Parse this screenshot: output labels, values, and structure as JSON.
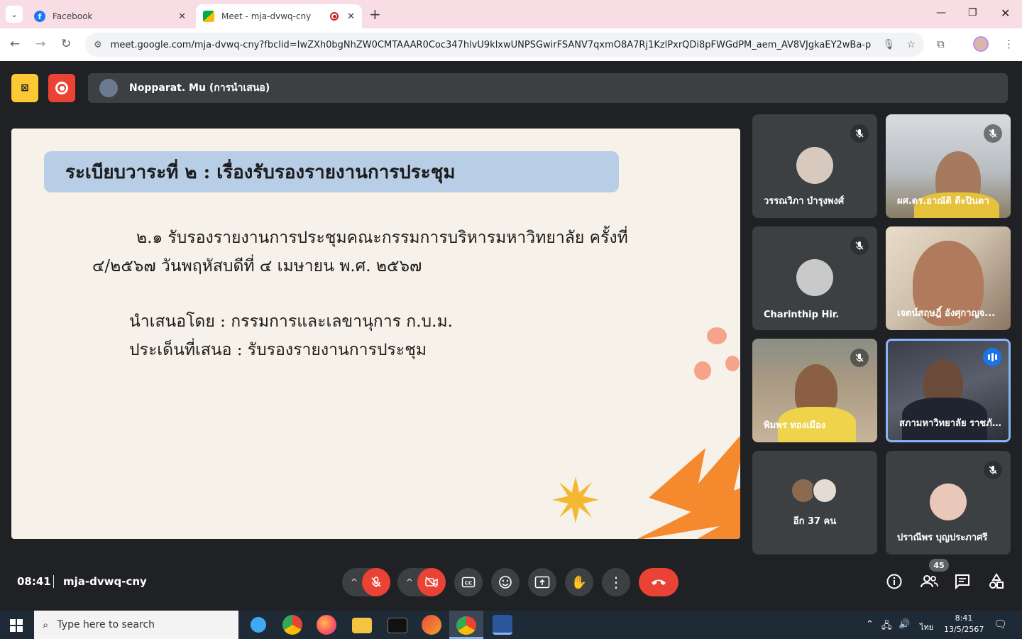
{
  "browser": {
    "tabs": [
      {
        "title": "Facebook",
        "active": false
      },
      {
        "title": "Meet - mja-dvwq-cny",
        "active": true
      }
    ],
    "url": "meet.google.com/mja-dvwq-cny?fbclid=IwZXh0bgNhZW0CMTAAAR0Coc347hlvU9klxwUNPSGwirFSANV7qxmO8A7Rj1KzlPxrQDi8pFWGdPM_aem_AV8VJgkaEY2wBa-px4kffx..."
  },
  "meet": {
    "presenter_name": "Nopparat. Mu (การนำเสนอ)",
    "slide": {
      "title": "ระเบียบวาระที่ ๒ : เรื่องรับรองรายงานการประชุม",
      "body": "๒.๑ รับรองรายงานการประชุมคณะกรรมการบริหารมหาวิทยาลัย ครั้งที่ ๔/๒๕๖๗ วันพฤหัสบดีที่ ๔ เมษายน พ.ศ. ๒๕๖๗",
      "presented_by": "นำเสนอโดย : กรรมการและเลขานุการ ก.บ.ม.",
      "issue": "ประเด็นที่เสนอ : รับรองรายงานการประชุม"
    },
    "participants": [
      {
        "name": "วรรณวิภา บำรุงพงศ์",
        "muted": true,
        "video": false
      },
      {
        "name": "ผศ.ดร.อาณัติ ดีะปินตา",
        "muted": true,
        "video": true
      },
      {
        "name": "Charinthip Hir.",
        "muted": true,
        "video": false
      },
      {
        "name": "เจตน์สฤษฎิ์ อังศุกาญจ...",
        "muted": false,
        "video": true
      },
      {
        "name": "พิมพร ทองเมือง",
        "muted": true,
        "video": true
      },
      {
        "name": "สภามหาวิทยาลัย ราชภั...",
        "muted": false,
        "video": true,
        "speaking": true
      },
      {
        "name": "อีก 37 คน",
        "muted": false,
        "video": false
      },
      {
        "name": "ปราณีพร บุญประภาศรี",
        "muted": true,
        "video": false
      }
    ],
    "clock": "08:41",
    "meeting_code": "mja-dvwq-cny",
    "people_count": "45"
  },
  "taskbar": {
    "search_placeholder": "Type here to search",
    "lang": "ไทย",
    "time": "8:41",
    "date": "13/5/2567"
  },
  "colors": {
    "accent": "#8ab4f8",
    "danger": "#ea4335",
    "slide_bg": "#f6f1e9",
    "slide_title_bg": "#b8cde6",
    "orange": "#f5892e"
  }
}
